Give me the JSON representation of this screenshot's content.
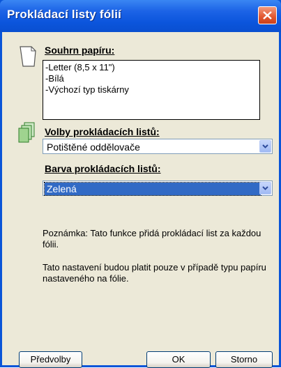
{
  "window": {
    "title": "Prokládací listy fólií"
  },
  "paper_summary": {
    "label": "Souhrn papíru:",
    "lines": [
      "-Letter (8,5 x 11\")",
      "-Bílá",
      "-Výchozí typ tiskárny"
    ]
  },
  "interleaf_options": {
    "label": "Volby prokládacích listů:",
    "selected": "Potištěné oddělovače"
  },
  "interleaf_color": {
    "label": "Barva prokládacích listů:",
    "selected": "Zelená"
  },
  "notes": {
    "note1": "Poznámka: Tato funkce přidá prokládací list za každou fólii.",
    "note2": "Tato nastavení budou platit pouze v případě typu papíru nastaveného na fólie."
  },
  "buttons": {
    "presets": "Předvolby",
    "ok": "OK",
    "cancel": "Storno"
  },
  "colors": {
    "titlebar": "#0a55d8",
    "dialog_bg": "#ece9d8",
    "selection": "#316ac5"
  }
}
